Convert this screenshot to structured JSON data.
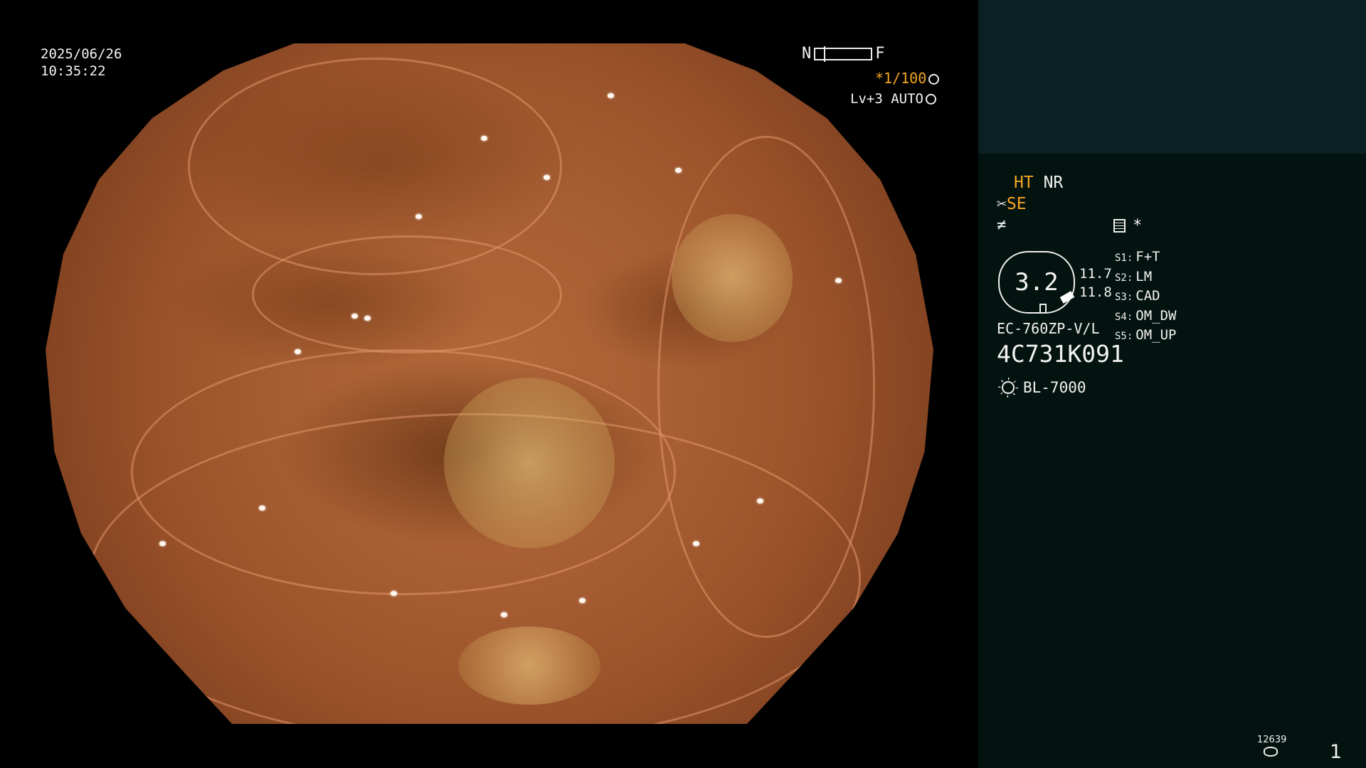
{
  "osd": {
    "date": "2025/06/26",
    "time": "10:35:22",
    "nf_left": "N",
    "nf_right": "F",
    "shutter": "*1/100",
    "level": "Lv+3 AUTO"
  },
  "panel": {
    "mode_ht": "HT",
    "mode_nr": "NR",
    "se": "SE",
    "fn_symbol": "≠",
    "asterisk": "*",
    "zoom": "3.2",
    "num1": "11.7",
    "num2": "11.8",
    "switches": [
      {
        "key": "S1:",
        "value": "F+T"
      },
      {
        "key": "S2:",
        "value": "LM"
      },
      {
        "key": "S3:",
        "value": "CAD"
      },
      {
        "key": "S4:",
        "value": "OM_DW"
      },
      {
        "key": "S5:",
        "value": "OM_UP"
      }
    ],
    "scope_model": "EC-760ZP-V/L",
    "scope_serial": "4C731K091",
    "light_source": "BL-7000",
    "storage_count": "12639",
    "page": "1"
  },
  "colors": {
    "accent": "#f5a623",
    "panel_bg": "#031310",
    "panel_top": "#0b2022"
  },
  "icons": [
    "shutter-icon",
    "auto-icon",
    "scissors-icon",
    "doc-icon",
    "sun-icon",
    "storage-icon"
  ]
}
